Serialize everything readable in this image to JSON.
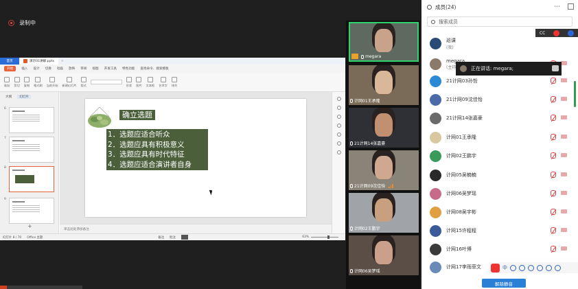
{
  "recording": {
    "label": "录制中"
  },
  "wps": {
    "tabs": [
      {
        "label": "首页"
      },
      {
        "label": "演示01讲解.pptx"
      }
    ],
    "menu": [
      "开始",
      "插入",
      "设计",
      "切换",
      "动画",
      "放映",
      "审阅",
      "视图",
      "开发工具",
      "特色功能",
      "查找命令、搜索模板"
    ],
    "toolbar": [
      "粘贴",
      "剪切",
      "复制",
      "格式刷",
      "当前开始",
      "新建幻灯片",
      "版式",
      "节",
      "重置",
      "形状",
      "图片",
      "文本框",
      "艺术字",
      "排列"
    ],
    "left_tabs": [
      "大纲",
      "幻灯片"
    ],
    "thumb_numbers": [
      "6",
      "7",
      "8",
      "9"
    ],
    "slide": {
      "title": "确立选题",
      "items": [
        "1．选题应适合听众",
        "2．选题应具有积极意义",
        "3．选题应具有时代特征",
        "4．选题应适合演讲者自身"
      ]
    },
    "notes_placeholder": "单击此处添加备注",
    "status": {
      "slide_count": "幻灯片 8 / 70",
      "theme": "Office 主题",
      "autosave": "备注",
      "comment": "批注",
      "zoom": "63%"
    }
  },
  "videos": [
    {
      "name": "megara",
      "active": true,
      "skin": "#c9a28a",
      "bg": "#5e6a60",
      "meter": true
    },
    {
      "name": "计网01王承隆",
      "active": false,
      "skin": "#d8b898",
      "bg": "#7a6a58",
      "meter": false
    },
    {
      "name": "21计网14张嘉豪",
      "active": false,
      "skin": "#c09070",
      "bg": "#2e3036",
      "meter": false
    },
    {
      "name": "21计网09沈佳怡",
      "active": false,
      "skin": "#d0a890",
      "bg": "#8a8478",
      "meter": true
    },
    {
      "name": "计网02王鹏宇",
      "active": false,
      "skin": "#c8a080",
      "bg": "#a0a4a8",
      "meter": false
    },
    {
      "name": "计网06吴梦瑶",
      "active": false,
      "skin": "#caa08a",
      "bg": "#5a4e46",
      "meter": false
    }
  ],
  "members": {
    "title": "成员(24)",
    "search_placeholder": "搜索成员",
    "list": [
      {
        "name": "巡课",
        "sub": "(我)",
        "avatar": "#2a4a78"
      },
      {
        "name": "megara",
        "sub": "(主持人)",
        "avatar": "#8a7a6a"
      },
      {
        "name": "21计网03孙哲",
        "sub": "",
        "avatar": "#2a8ad6"
      },
      {
        "name": "21计网09沈佳怡",
        "sub": "",
        "avatar": "#4a6aa8"
      },
      {
        "name": "21计网14张嘉豪",
        "sub": "",
        "avatar": "#6a6a6a"
      },
      {
        "name": "计网01王承隆",
        "sub": "",
        "avatar": "#d8c8a0"
      },
      {
        "name": "计网02王鹏宇",
        "sub": "",
        "avatar": "#3a9a5a"
      },
      {
        "name": "计网05吴楠楠",
        "sub": "",
        "avatar": "#2a2a2a"
      },
      {
        "name": "计网06吴梦瑶",
        "sub": "",
        "avatar": "#c86a8a"
      },
      {
        "name": "计网08吴宇彬",
        "sub": "",
        "avatar": "#e0a040"
      },
      {
        "name": "计网15许程程",
        "sub": "",
        "avatar": "#3a5a9a"
      },
      {
        "name": "计网16叶博",
        "sub": "",
        "avatar": "#3a3a3a"
      },
      {
        "name": "计网17李雨菲文",
        "sub": "",
        "avatar": "#6a8ab8"
      }
    ],
    "speaking": "正在讲话: megara;",
    "cc": "CC",
    "ime": "中",
    "unmute_all": "解除静音"
  }
}
